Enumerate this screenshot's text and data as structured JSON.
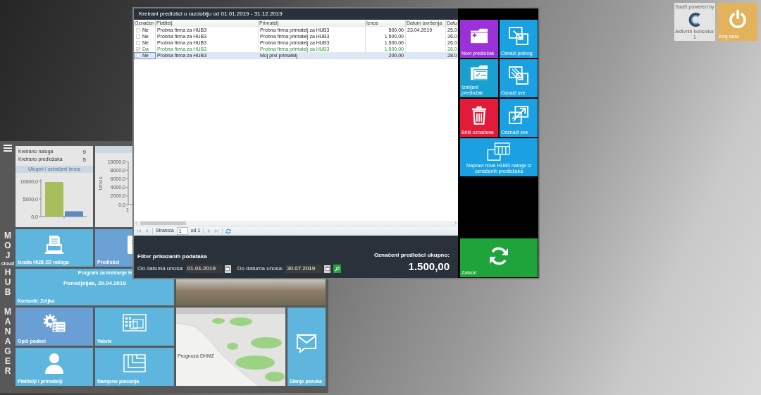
{
  "dashboard": {
    "brand": [
      {
        "text": "MOJ",
        "kind": "stacked"
      },
      {
        "text": "cloud",
        "kind": "small"
      },
      {
        "text": "HUB",
        "kind": "stacked"
      },
      {
        "text": "MANAGER",
        "kind": "stacked"
      }
    ],
    "stats": {
      "rows": [
        {
          "label": "Kreirano naloga",
          "value": "9"
        },
        {
          "label": "Kreirano predložaka",
          "value": "5"
        }
      ],
      "chart_title": "Ukupni / označeni iznos",
      "chart_data": {
        "type": "bar",
        "ylim": [
          0,
          10000
        ],
        "yticks": [
          {
            "value": 0,
            "label": "0,0"
          },
          {
            "value": 5000,
            "label": "5000,0"
          },
          {
            "value": 10000,
            "label": "10000,0"
          }
        ],
        "series": [
          {
            "color": "#a8bd5c",
            "values": [
              9800
            ]
          },
          {
            "color": "#5c89c0",
            "values": [
              1500
            ]
          }
        ]
      }
    },
    "amount_chart": {
      "axis_title": "Iznos",
      "y_tick_labels": [
        "10000,0",
        "8000,0",
        "6000,0",
        "4000,0",
        "2000,0",
        "0,0"
      ],
      "x_tick_labels": [
        "1"
      ]
    },
    "launch_tiles": [
      {
        "label": "Izrada HUB 2D naloga",
        "color": "#5eb6de"
      },
      {
        "label": "Predlošci",
        "color": "#6aa2d6"
      },
      {
        "label": "Opći podaci",
        "color": "#6a9fd5"
      },
      {
        "label": "Valute",
        "color": "#5eb6de"
      },
      {
        "label": "Platitelji i primatelji",
        "color": "#5eb6de"
      },
      {
        "label": "Namjene plaćanja",
        "color": "#5eb6de"
      },
      {
        "label": "Slanje poruka",
        "color": "#5eb6de"
      }
    ],
    "welcome_tile": {
      "title": "Program za kreiranje H",
      "date": "Ponedjeljak, 29.04.2019",
      "user": "Korisnik: Zeljko"
    },
    "weather_map": {
      "caption": "Prognoza DHMZ"
    }
  },
  "top_right": {
    "powered_by": {
      "title": "SaaS powered by",
      "active_users": "Aktivnih korisnika: 1"
    },
    "logout": {
      "label": "Kraj rada"
    }
  },
  "dialog": {
    "title": "Kreirani predlošci u razdoblju od 01.01.2019 - 31.12.2019",
    "table": {
      "columns": [
        "Označen",
        "Platitelj",
        "Primatelj",
        "Iznos",
        "Datum izvršenja",
        "Datu"
      ],
      "rows": [
        {
          "marked": "Ne",
          "checked": false,
          "payer": "Probna firma za HUB3",
          "payee": "Probna firma primatelj za HUB3",
          "amount": "500,00",
          "execution_date": "23.04.2019",
          "column_6": "25.0",
          "selected": false
        },
        {
          "marked": "Ne",
          "checked": false,
          "payer": "Probna firma za HUB3",
          "payee": "Probna firma primatelj za HUB3",
          "amount": "1.500,00",
          "execution_date": "",
          "column_6": "26.0",
          "selected": false
        },
        {
          "marked": "Ne",
          "checked": false,
          "payer": "Probna firma za HUB3",
          "payee": "Probna firma primatelj za HUB3",
          "amount": "1.500,00",
          "execution_date": "",
          "column_6": "26.0",
          "selected": false
        },
        {
          "marked": "Da",
          "checked": true,
          "payer": "Probna firma za HUB3",
          "payee": "Probna firma primatelj za HUB3",
          "amount": "1.500,00",
          "execution_date": "",
          "column_6": "28.0",
          "selected": false
        },
        {
          "marked": "Ne",
          "checked": false,
          "payer": "Probna firma za HUB3",
          "payee": "Moj prvi primatelj",
          "amount": "200,00",
          "execution_date": "",
          "column_6": "28.0",
          "selected": true
        }
      ]
    },
    "pager": {
      "page_label": "Stranica",
      "page": "1",
      "page_count": "od 1",
      "navigation_disabled": true
    },
    "filter": {
      "title": "Filter prikazanih podataka",
      "from_label": "Od datuma unosa:",
      "from_value": "01.01.2019",
      "to_label": "Do datuma unosa:",
      "to_value": "30.07.2019"
    },
    "total": {
      "label": "Označeni predlošci ukupno:",
      "value": "1.500,00"
    },
    "actions": [
      {
        "label": "Novi predložak",
        "color": "#9b31d8",
        "kind": "square"
      },
      {
        "label": "Označi jednog",
        "color": "#1ba1e2",
        "kind": "square"
      },
      {
        "label": "Izmijeni predložak",
        "color": "#1aa0cf",
        "kind": "square"
      },
      {
        "label": "Označi sve",
        "color": "#1ba1e2",
        "kind": "square"
      },
      {
        "label": "Briši označene",
        "color": "#e31b3b",
        "kind": "square"
      },
      {
        "label": "Odznači sve",
        "color": "#1ba1e2",
        "kind": "square"
      },
      {
        "label": "Napravi nove HUB3 naloge iz označenih predložaka",
        "color": "#1ba1e2",
        "kind": "wide"
      }
    ],
    "close_action": {
      "label": "Zatvori",
      "color": "#1fa43c"
    }
  }
}
